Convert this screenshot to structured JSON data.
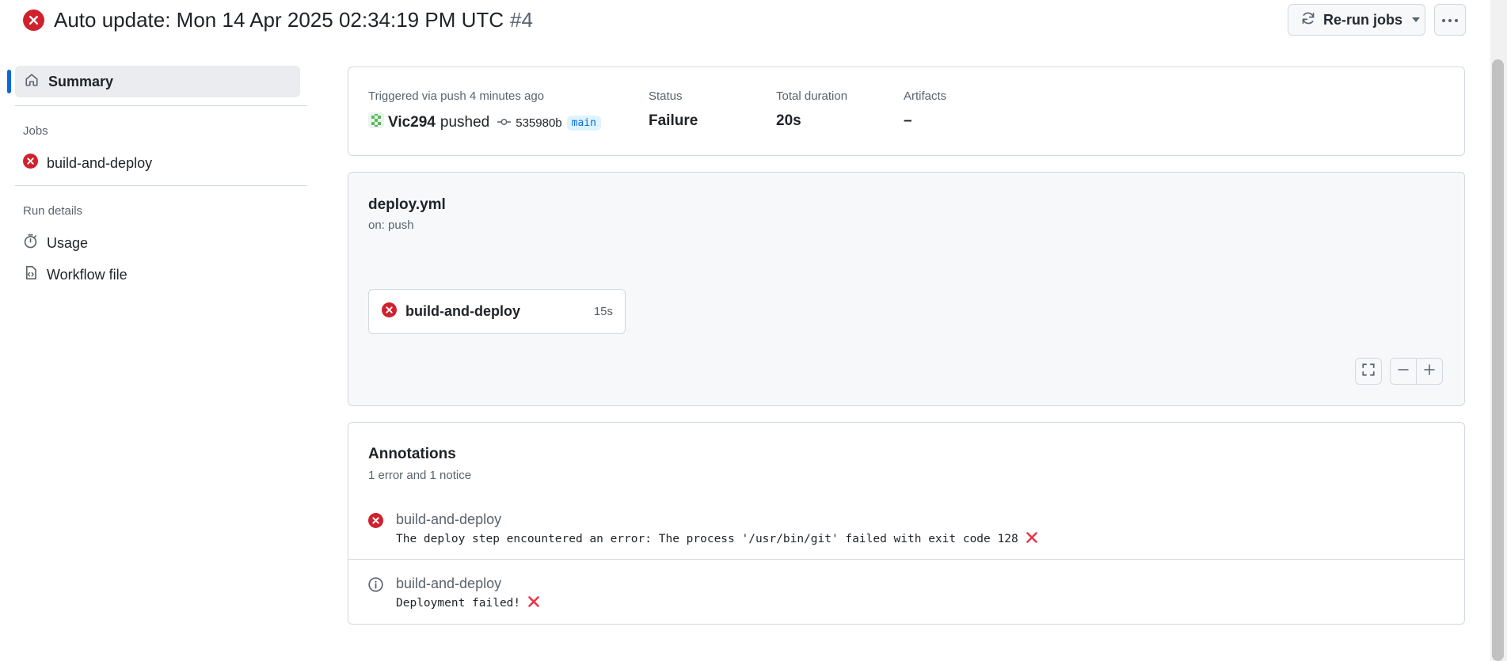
{
  "header": {
    "title": "Auto update: Mon 14 Apr 2025 02:34:19 PM UTC",
    "run_number": "#4",
    "rerun_label": "Re-run jobs"
  },
  "sidebar": {
    "summary_label": "Summary",
    "jobs_heading": "Jobs",
    "jobs": [
      {
        "label": "build-and-deploy",
        "status": "failure"
      }
    ],
    "run_details_heading": "Run details",
    "usage_label": "Usage",
    "workflow_file_label": "Workflow file"
  },
  "summary": {
    "trigger_text": "Triggered via push 4 minutes ago",
    "user": "Vic294",
    "pushed_text": "pushed",
    "commit_sha": "535980b",
    "branch": "main",
    "status_label": "Status",
    "status_value": "Failure",
    "duration_label": "Total duration",
    "duration_value": "20s",
    "artifacts_label": "Artifacts",
    "artifacts_value": "–"
  },
  "graph": {
    "workflow_file": "deploy.yml",
    "trigger": "on: push",
    "job": {
      "name": "build-and-deploy",
      "duration": "15s",
      "status": "failure"
    }
  },
  "annotations": {
    "title": "Annotations",
    "subtitle": "1 error and 1 notice",
    "items": [
      {
        "type": "error",
        "job": "build-and-deploy",
        "message": "The deploy step encountered an error: The process '/usr/bin/git' failed with exit code 128"
      },
      {
        "type": "notice",
        "job": "build-and-deploy",
        "message": "Deployment failed!"
      }
    ]
  },
  "colors": {
    "failure": "#cf222e",
    "accent": "#0969da",
    "emoji_cross": "#e8364f"
  }
}
